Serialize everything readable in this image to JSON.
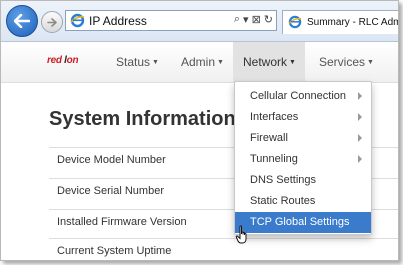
{
  "browser": {
    "address": "IP Address",
    "address_tools": [
      "⌕",
      "▾",
      "⊠",
      "↻"
    ],
    "tab_title": "Summary - RLC Adm"
  },
  "navbar": {
    "logo_red": "red",
    "logo_dark": "l",
    "logo_red2": "on",
    "items": [
      {
        "label": "Status"
      },
      {
        "label": "Admin"
      },
      {
        "label": "Network"
      },
      {
        "label": "Services"
      }
    ]
  },
  "page": {
    "heading": "System Information",
    "rows": [
      "Device Model Number",
      "Device Serial Number",
      "Installed Firmware Version",
      "Current System Uptime"
    ]
  },
  "network_menu": {
    "items": [
      {
        "label": "Cellular Connection",
        "submenu": true
      },
      {
        "label": "Interfaces",
        "submenu": true
      },
      {
        "label": "Firewall",
        "submenu": true
      },
      {
        "label": "Tunneling",
        "submenu": true
      },
      {
        "label": "DNS Settings",
        "submenu": false
      },
      {
        "label": "Static Routes",
        "submenu": false
      },
      {
        "label": "TCP Global Settings",
        "submenu": false,
        "highlighted": true
      }
    ]
  },
  "colors": {
    "accent": "#3a7ccb",
    "logo_red": "#cc1f26"
  }
}
